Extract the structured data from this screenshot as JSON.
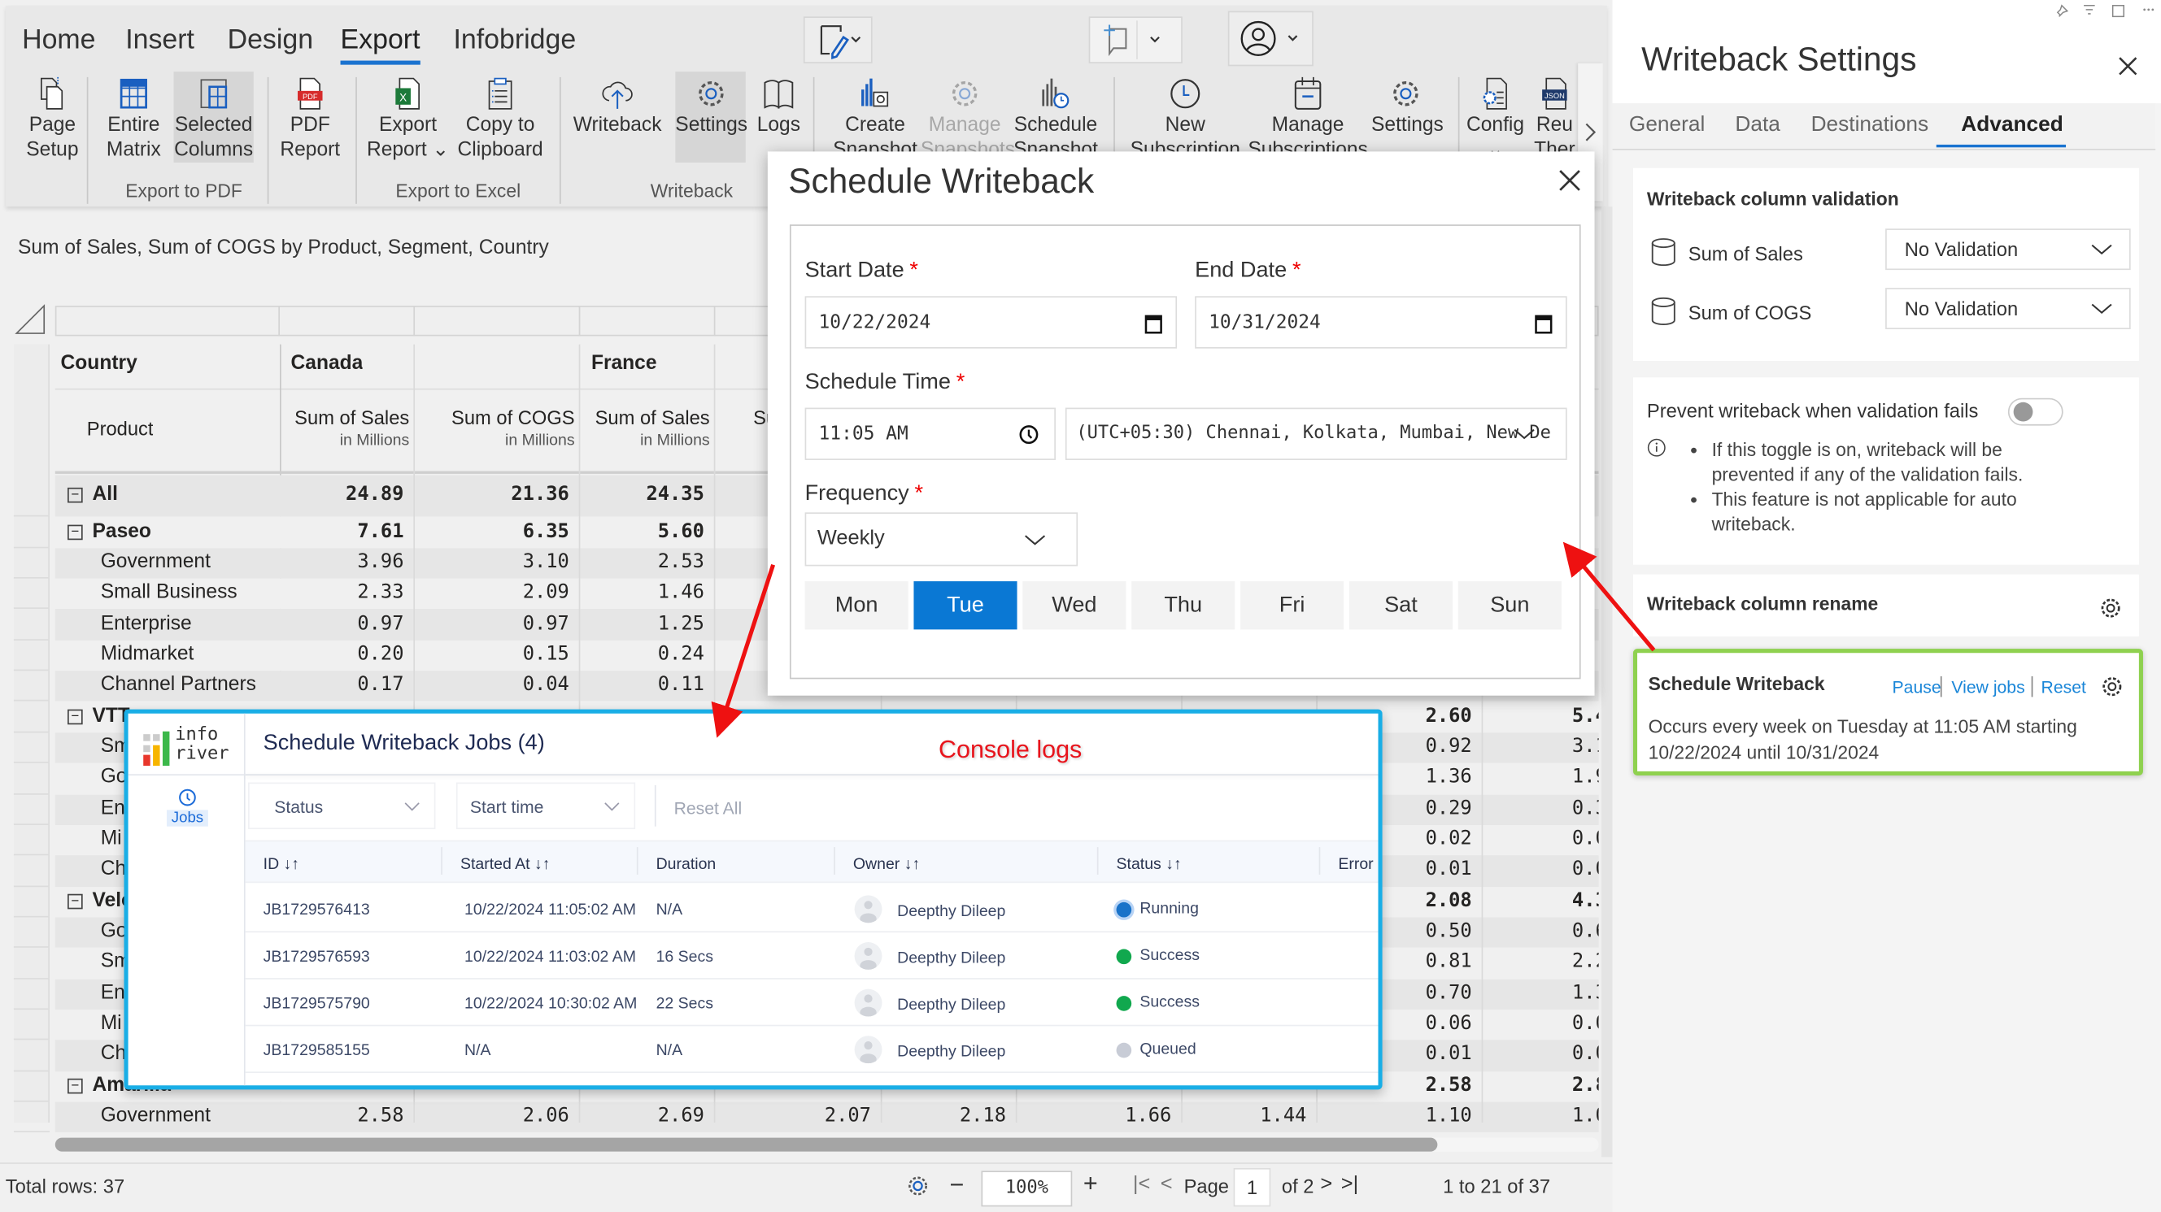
{
  "ribbon": {
    "tabs": [
      {
        "label": "Home",
        "active": false
      },
      {
        "label": "Insert",
        "active": false
      },
      {
        "label": "Design",
        "active": false
      },
      {
        "label": "Export",
        "active": true
      },
      {
        "label": "Infobridge",
        "active": false
      }
    ],
    "buttons": [
      {
        "id": "page-setup",
        "icon": "page-setup-icon",
        "lines": [
          "Page",
          "Setup"
        ]
      },
      {
        "id": "entire-matrix",
        "icon": "grid-icon",
        "lines": [
          "Entire",
          "Matrix"
        ]
      },
      {
        "id": "selected-columns",
        "icon": "columns-icon",
        "lines": [
          "Selected",
          "Columns"
        ],
        "highlighted": true
      },
      {
        "id": "pdf-report",
        "icon": "pdf-icon",
        "lines": [
          "PDF",
          "Report"
        ]
      },
      {
        "id": "export-report",
        "icon": "excel-icon",
        "lines": [
          "Export",
          "Report ⌄"
        ]
      },
      {
        "id": "copy-to-clipboard",
        "icon": "clipboard-icon",
        "lines": [
          "Copy to",
          "Clipboard"
        ]
      },
      {
        "id": "writeback",
        "icon": "cloud-upload-icon",
        "lines": [
          "Writeback",
          ""
        ]
      },
      {
        "id": "writeback-settings",
        "icon": "gear-icon",
        "lines": [
          "Settings",
          ""
        ],
        "highlighted": true
      },
      {
        "id": "logs",
        "icon": "book-icon",
        "lines": [
          "Logs",
          ""
        ]
      },
      {
        "id": "create-snapshot",
        "icon": "chart-camera-icon",
        "lines": [
          "Create",
          "Snapshot"
        ]
      },
      {
        "id": "manage-snapshots",
        "icon": "gear-icon",
        "lines": [
          "Manage",
          "Snapshots"
        ],
        "disabled": true
      },
      {
        "id": "schedule-snapshot",
        "icon": "chart-clock-icon",
        "lines": [
          "Schedule",
          "Snapshot"
        ]
      },
      {
        "id": "new-subscription",
        "icon": "clock-icon",
        "lines": [
          "New",
          "Subscription"
        ]
      },
      {
        "id": "manage-subscriptions",
        "icon": "calendar-icon",
        "lines": [
          "Manage",
          "Subscriptions"
        ]
      },
      {
        "id": "subscription-settings",
        "icon": "gear-icon",
        "lines": [
          "Settings",
          ""
        ]
      },
      {
        "id": "config",
        "icon": "config-icon",
        "lines": [
          "Config",
          "⌄"
        ]
      },
      {
        "id": "reuse-theme",
        "icon": "json-icon",
        "lines": [
          "Reu",
          "Ther"
        ]
      }
    ],
    "groups": [
      "Export to PDF",
      "Export to Excel",
      "Writeback"
    ]
  },
  "visual": {
    "subtitle": "Sum of Sales, Sum of COGS by Product, Segment, Country"
  },
  "grid": {
    "country_header": "Country",
    "product_header": "Product",
    "countries": [
      "Canada",
      "France"
    ],
    "measure_headers": [
      {
        "name": "Sum of Sales",
        "unit": "in Millions"
      },
      {
        "name": "Sum of COGS",
        "unit": "in Millions"
      },
      {
        "name": "Sum of Sales",
        "unit": "in Millions"
      },
      {
        "name": "Sum of COGS",
        "unit": "in Millions"
      }
    ],
    "rows": [
      {
        "label": "All",
        "group": true,
        "values": [
          "24.89",
          "21.36",
          "24.35",
          null,
          null,
          null,
          null,
          null,
          null
        ]
      },
      {
        "label": "Paseo",
        "group": true,
        "values": [
          "7.61",
          "6.35",
          "5.60",
          null,
          null,
          null,
          null,
          null,
          null
        ]
      },
      {
        "label": "Government",
        "values": [
          "3.96",
          "3.10",
          "2.53",
          null,
          null,
          null,
          null,
          null,
          null
        ]
      },
      {
        "label": "Small Business",
        "values": [
          "2.33",
          "2.09",
          "1.46",
          null,
          null,
          null,
          null,
          null,
          null
        ]
      },
      {
        "label": "Enterprise",
        "values": [
          "0.97",
          "0.97",
          "1.25",
          null,
          null,
          null,
          null,
          null,
          null
        ]
      },
      {
        "label": "Midmarket",
        "values": [
          "0.20",
          "0.15",
          "0.24",
          null,
          null,
          null,
          null,
          null,
          null
        ]
      },
      {
        "label": "Channel Partners",
        "values": [
          "0.17",
          "0.04",
          "0.11",
          null,
          null,
          null,
          null,
          null,
          null
        ]
      },
      {
        "label": "VTT",
        "group": true,
        "values": [
          null,
          null,
          null,
          null,
          null,
          null,
          null,
          "2.60",
          "5.4"
        ]
      },
      {
        "label": "Sm",
        "values": [
          null,
          null,
          null,
          null,
          null,
          null,
          null,
          "0.92",
          "3.1"
        ]
      },
      {
        "label": "Go",
        "values": [
          null,
          null,
          null,
          null,
          null,
          null,
          null,
          "1.36",
          "1.9"
        ]
      },
      {
        "label": "Ent",
        "values": [
          null,
          null,
          null,
          null,
          null,
          null,
          null,
          "0.29",
          "0.3"
        ]
      },
      {
        "label": "Mi",
        "values": [
          null,
          null,
          null,
          null,
          null,
          null,
          null,
          "0.02",
          "0.0"
        ]
      },
      {
        "label": "Ch",
        "values": [
          null,
          null,
          null,
          null,
          null,
          null,
          null,
          "0.01",
          "0.0"
        ]
      },
      {
        "label": "Velo",
        "group": true,
        "values": [
          null,
          null,
          null,
          null,
          null,
          null,
          null,
          "2.08",
          "4.3"
        ]
      },
      {
        "label": "Go",
        "values": [
          null,
          null,
          null,
          null,
          null,
          null,
          null,
          "0.50",
          "0.6"
        ]
      },
      {
        "label": "Sm",
        "values": [
          null,
          null,
          null,
          null,
          null,
          null,
          null,
          "0.81",
          "2.2"
        ]
      },
      {
        "label": "Ent",
        "values": [
          null,
          null,
          null,
          null,
          null,
          null,
          null,
          "0.70",
          "1.3"
        ]
      },
      {
        "label": "Mi",
        "values": [
          null,
          null,
          null,
          null,
          null,
          null,
          null,
          "0.06",
          "0.0"
        ]
      },
      {
        "label": "Ch",
        "values": [
          null,
          null,
          null,
          null,
          null,
          null,
          null,
          "0.01",
          "0.0"
        ]
      },
      {
        "label": "Amarilla",
        "group": true,
        "values": [
          null,
          null,
          null,
          null,
          null,
          null,
          null,
          "2.58",
          "2.8"
        ]
      },
      {
        "label": "Government",
        "values": [
          "2.58",
          "2.06",
          "2.69",
          "2.07",
          "2.18",
          "1.66",
          "1.44",
          "1.10",
          "1.0"
        ]
      }
    ]
  },
  "footer": {
    "total_rows": "Total rows: 37",
    "zoom": "100%",
    "page_label": "Page",
    "page": "1",
    "of_pages": "of 2",
    "range": "1 to 21 of 37"
  },
  "schedule_dialog": {
    "title": "Schedule Writeback",
    "start_date_label": "Start Date",
    "start_date": "10/22/2024",
    "end_date_label": "End Date",
    "end_date": "10/31/2024",
    "time_label": "Schedule Time",
    "time": "11:05 AM",
    "timezone": "(UTC+05:30) Chennai, Kolkata, Mumbai, New De",
    "frequency_label": "Frequency",
    "frequency": "Weekly",
    "required_mark": "*",
    "days": [
      {
        "label": "Mon",
        "selected": false
      },
      {
        "label": "Tue",
        "selected": true
      },
      {
        "label": "Wed",
        "selected": false
      },
      {
        "label": "Thu",
        "selected": false
      },
      {
        "label": "Fri",
        "selected": false
      },
      {
        "label": "Sat",
        "selected": false
      },
      {
        "label": "Sun",
        "selected": false
      }
    ],
    "accent_color": "#0a78d4"
  },
  "jobs_dialog": {
    "logo_text": [
      "info",
      "river"
    ],
    "nav_item": "Jobs",
    "title": "Schedule Writeback Jobs (4)",
    "annotation": "Console logs",
    "filters": {
      "status": "Status",
      "start_time": "Start time",
      "reset": "Reset All"
    },
    "columns": [
      "ID ↓↑",
      "Started At ↓↑",
      "Duration",
      "Owner ↓↑",
      "Status ↓↑",
      "Error"
    ],
    "rows": [
      {
        "id": "JB1729576413",
        "started": "10/22/2024 11:05:02 AM",
        "duration": "N/A",
        "owner": "Deepthy Dileep",
        "status": "Running",
        "status_color": "#1a73c9"
      },
      {
        "id": "JB1729576593",
        "started": "10/22/2024 11:03:02 AM",
        "duration": "16 Secs",
        "owner": "Deepthy Dileep",
        "status": "Success",
        "status_color": "#11a84e"
      },
      {
        "id": "JB1729575790",
        "started": "10/22/2024 10:30:02 AM",
        "duration": "22 Secs",
        "owner": "Deepthy Dileep",
        "status": "Success",
        "status_color": "#11a84e"
      },
      {
        "id": "JB1729585155",
        "started": "N/A",
        "duration": "N/A",
        "owner": "Deepthy Dileep",
        "status": "Queued",
        "status_color": "#c8ccd6"
      }
    ],
    "border_color": "#19aee6"
  },
  "settings_panel": {
    "title": "Writeback Settings",
    "tabs": [
      {
        "label": "General",
        "active": false
      },
      {
        "label": "Data",
        "active": false
      },
      {
        "label": "Destinations",
        "active": false
      },
      {
        "label": "Advanced",
        "active": true
      }
    ],
    "validation": {
      "title": "Writeback column validation",
      "columns": [
        {
          "name": "Sum of Sales",
          "value": "No Validation"
        },
        {
          "name": "Sum of COGS",
          "value": "No Validation"
        }
      ]
    },
    "prevent": {
      "label": "Prevent writeback when validation fails",
      "enabled": false,
      "notes": [
        "If this toggle is on, writeback will be prevented if any of the validation fails.",
        "This feature is not applicable for auto writeback."
      ]
    },
    "rename": {
      "title": "Writeback column rename"
    },
    "schedule": {
      "title": "Schedule Writeback",
      "pause": "Pause",
      "view_jobs": "View jobs",
      "reset": "Reset",
      "description": "Occurs every week on Tuesday at 11:05 AM starting 10/22/2024 until 10/31/2024",
      "highlight_color": "#8fd14f"
    }
  }
}
